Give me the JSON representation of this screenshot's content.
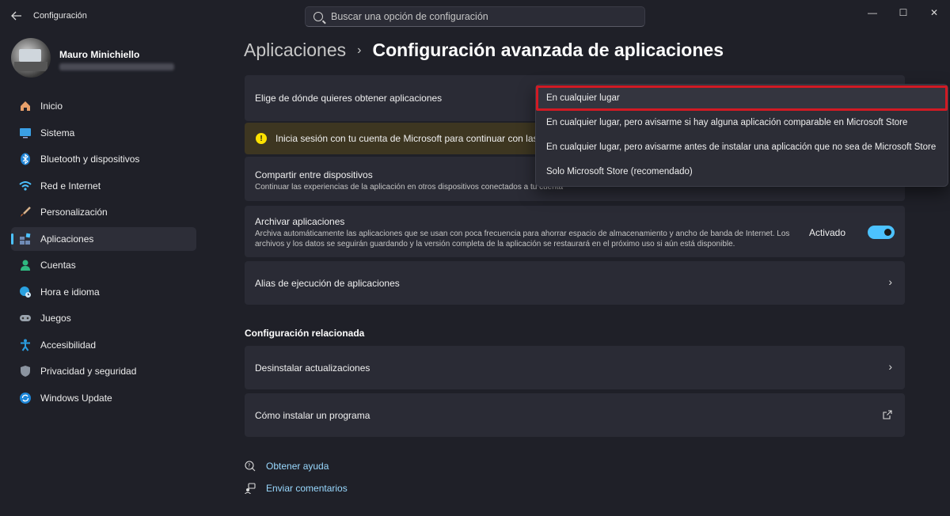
{
  "window": {
    "title": "Configuración",
    "controls": {
      "minimize": "—",
      "maximize": "☐",
      "close": "✕"
    }
  },
  "search": {
    "placeholder": "Buscar una opción de configuración"
  },
  "profile": {
    "name": "Mauro Minichiello"
  },
  "sidebar": {
    "items": [
      {
        "label": "Inicio",
        "icon": "home-icon"
      },
      {
        "label": "Sistema",
        "icon": "monitor-icon"
      },
      {
        "label": "Bluetooth y dispositivos",
        "icon": "bluetooth-icon"
      },
      {
        "label": "Red e Internet",
        "icon": "wifi-icon"
      },
      {
        "label": "Personalización",
        "icon": "brush-icon"
      },
      {
        "label": "Aplicaciones",
        "icon": "apps-icon",
        "active": true
      },
      {
        "label": "Cuentas",
        "icon": "person-icon"
      },
      {
        "label": "Hora e idioma",
        "icon": "globe-clock-icon"
      },
      {
        "label": "Juegos",
        "icon": "gamepad-icon"
      },
      {
        "label": "Accesibilidad",
        "icon": "accessibility-icon"
      },
      {
        "label": "Privacidad y seguridad",
        "icon": "shield-icon"
      },
      {
        "label": "Windows Update",
        "icon": "update-icon"
      }
    ]
  },
  "breadcrumb": {
    "parent": "Aplicaciones",
    "separator": "›",
    "current": "Configuración avanzada de aplicaciones"
  },
  "settings": {
    "source": {
      "title": "Elige de dónde quieres obtener aplicaciones"
    },
    "warning": {
      "text": "Inicia sesión con tu cuenta de Microsoft para continuar con las c"
    },
    "share": {
      "title": "Compartir entre dispositivos",
      "desc": "Continuar las experiencias de la aplicación en otros dispositivos conectados a tu cuenta"
    },
    "archive": {
      "title": "Archivar aplicaciones",
      "desc_line1": "Archiva automáticamente las aplicaciones que se usan con poca frecuencia para ahorrar espacio de almacenamiento y ancho de banda de Internet. Los",
      "desc_line2": "archivos y los datos se seguirán guardando y la versión completa de la aplicación se restaurará en el próximo uso si aún está disponible.",
      "toggle_label": "Activado",
      "toggle_on": true
    },
    "alias": {
      "title": "Alias de ejecución de aplicaciones"
    }
  },
  "related": {
    "title": "Configuración relacionada",
    "uninstall_updates": "Desinstalar actualizaciones",
    "install_program": "Cómo instalar un programa"
  },
  "links": {
    "help": "Obtener ayuda",
    "feedback": "Enviar comentarios"
  },
  "dropdown": {
    "options": [
      "En cualquier lugar",
      "En cualquier lugar, pero avisarme si hay alguna aplicación comparable en Microsoft Store",
      "En cualquier lugar, pero avisarme antes de instalar una aplicación que no sea de Microsoft Store",
      "Solo Microsoft Store (recomendado)"
    ],
    "selected": "En cualquier lugar"
  },
  "colors": {
    "accent": "#4cc2ff",
    "highlight_border": "#d11a24",
    "warning_bg": "#3d3621"
  }
}
